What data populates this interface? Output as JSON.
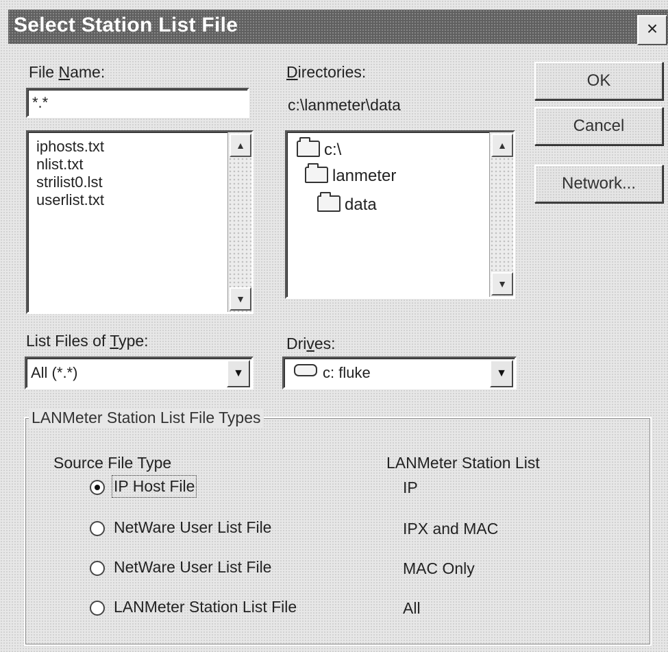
{
  "dialog": {
    "title": "Select Station List File",
    "close_label": "×"
  },
  "file_name": {
    "label_pre": "File ",
    "label_key": "N",
    "label_post": "ame:",
    "value": "*.*"
  },
  "files": [
    "iphosts.txt",
    "nlist.txt",
    "strilist0.lst",
    "userlist.txt"
  ],
  "directories": {
    "label_pre": "",
    "label_key": "D",
    "label_post": "irectories:",
    "current_path": "c:\\lanmeter\\data",
    "items": [
      "c:\\",
      "lanmeter",
      "data"
    ]
  },
  "buttons": {
    "ok": "OK",
    "cancel": "Cancel",
    "network": "Network..."
  },
  "file_type": {
    "label_pre": "List Files of ",
    "label_key": "T",
    "label_post": "ype:",
    "selected": "All (*.*)"
  },
  "drives": {
    "label_pre": "Dri",
    "label_key": "v",
    "label_post": "es:",
    "selected": "c: fluke"
  },
  "group": {
    "title": "LANMeter Station List File Types",
    "col_source": "Source File Type",
    "col_list": "LANMeter Station List",
    "options": [
      {
        "label": "IP Host File",
        "result": "IP",
        "selected": true
      },
      {
        "label": "NetWare User List File",
        "result": "IPX and MAC",
        "selected": false
      },
      {
        "label": "NetWare User List File",
        "result": "MAC Only",
        "selected": false
      },
      {
        "label": "LANMeter Station List File",
        "result": "All",
        "selected": false
      }
    ]
  }
}
